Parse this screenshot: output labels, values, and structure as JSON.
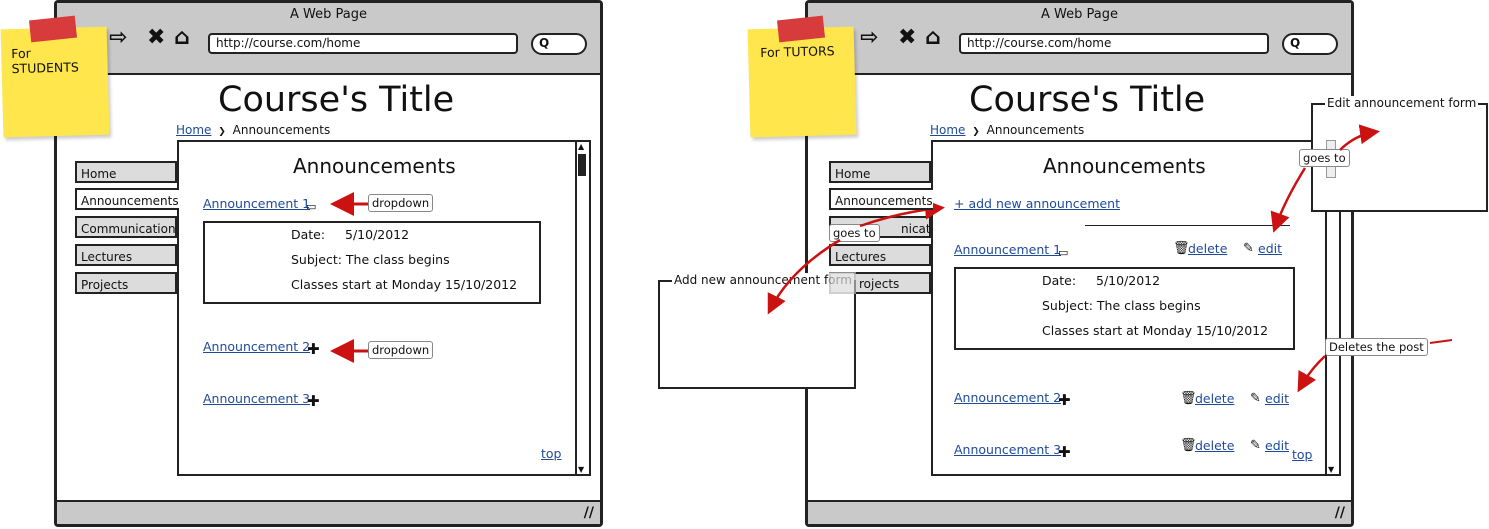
{
  "browser": {
    "title": "A Web Page",
    "url": "http://course.com/home",
    "search_glyph": "Q"
  },
  "page": {
    "course_title": "Course's Title",
    "breadcrumb_home": "Home",
    "breadcrumb_sep": "❯",
    "breadcrumb_current": "Announcements",
    "panel_title": "Announcements",
    "top_link": "top"
  },
  "sidebar": {
    "items": [
      {
        "label": "Home"
      },
      {
        "label": "Announcements"
      },
      {
        "label": "Communication"
      },
      {
        "label": "Lectures"
      },
      {
        "label": "Projects"
      }
    ]
  },
  "announcements": [
    {
      "title": "Announcement 1",
      "expanded": true
    },
    {
      "title": "Announcement 2",
      "expanded": false
    },
    {
      "title": "Announcement 3",
      "expanded": false
    }
  ],
  "detail": {
    "date_label": "Date:",
    "date_value": "5/10/2012",
    "subject": "Subject: The class begins",
    "body": "Classes start at Monday 15/10/2012"
  },
  "students": {
    "note": "For\nSTUDENTS",
    "callout": "dropdown"
  },
  "tutors": {
    "note": "For TUTORS",
    "add_link": "+ add new announcement",
    "delete_label": "delete",
    "edit_label": "edit",
    "partial_tab": "nication",
    "partial_tab2": "rojects",
    "goes_to": "goes to",
    "deletes_callout": "Deletes the post",
    "edit_form_title": "Edit announcement form",
    "add_form_title": "Add new announcement form"
  },
  "colors": {
    "chrome": "#c9c9c9",
    "link": "#1f4a9a",
    "arrow": "#cc1111",
    "sticky": "#ffe64d",
    "tape": "#d83b3b"
  }
}
